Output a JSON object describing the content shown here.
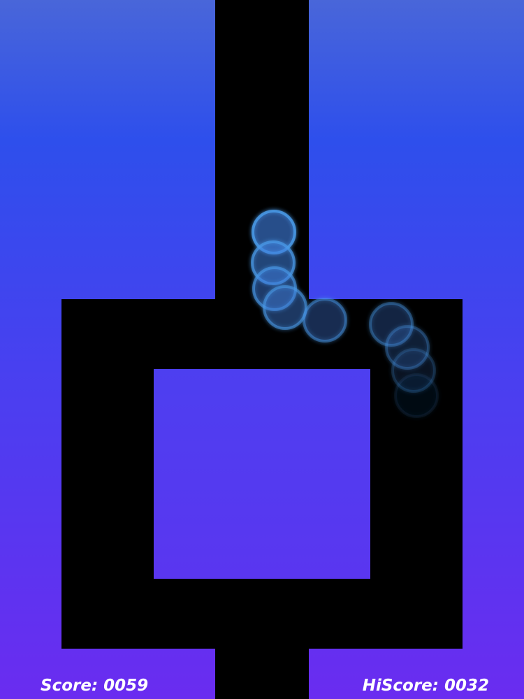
{
  "game": {
    "background_top_color": "#4966d9",
    "background_bottom_color": "#6a2cf0",
    "track_color": "#000000",
    "ball_color": "#3f7fe0"
  },
  "hud": {
    "score_label": "Score: 0059",
    "hiscore_label": "HiScore: 0032"
  }
}
